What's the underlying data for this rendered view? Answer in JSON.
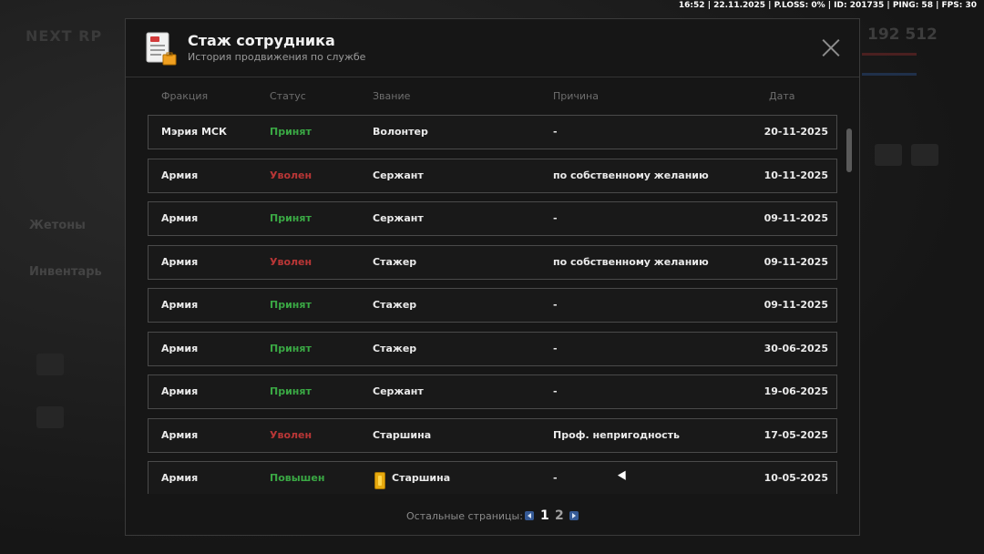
{
  "hud": "16:52 | 22.11.2025 | P.LOSS: 0% | ID: 201735 | PING: 58 | FPS: 30",
  "modal": {
    "title": "Стаж сотрудника",
    "subtitle": "История продвижения по службе"
  },
  "columns": {
    "faction": "Фракция",
    "status": "Статус",
    "rank": "Звание",
    "reason": "Причина",
    "date": "Дата"
  },
  "rows": [
    {
      "faction": "Мэрия МСК",
      "status": "Принят",
      "status_type": "accepted",
      "rank": "Волонтер",
      "reason": "-",
      "date": "20-11-2025"
    },
    {
      "faction": "Армия",
      "status": "Уволен",
      "status_type": "fired",
      "rank": "Сержант",
      "reason": "по собственному желанию",
      "date": "10-11-2025"
    },
    {
      "faction": "Армия",
      "status": "Принят",
      "status_type": "accepted",
      "rank": "Сержант",
      "reason": "-",
      "date": "09-11-2025"
    },
    {
      "faction": "Армия",
      "status": "Уволен",
      "status_type": "fired",
      "rank": "Стажер",
      "reason": "по собственному желанию",
      "date": "09-11-2025"
    },
    {
      "faction": "Армия",
      "status": "Принят",
      "status_type": "accepted",
      "rank": "Стажер",
      "reason": "-",
      "date": "09-11-2025"
    },
    {
      "faction": "Армия",
      "status": "Принят",
      "status_type": "accepted",
      "rank": "Стажер",
      "reason": "-",
      "date": "30-06-2025"
    },
    {
      "faction": "Армия",
      "status": "Принят",
      "status_type": "accepted",
      "rank": "Сержант",
      "reason": "-",
      "date": "19-06-2025"
    },
    {
      "faction": "Армия",
      "status": "Уволен",
      "status_type": "fired",
      "rank": "Старшина",
      "reason": "Проф. непригодность",
      "date": "17-05-2025"
    },
    {
      "faction": "Армия",
      "status": "Повышен",
      "status_type": "promoted",
      "rank": "Старшина",
      "reason": "-",
      "date": "10-05-2025",
      "rank_icon": "rank-badge-icon"
    }
  ],
  "pager": {
    "label": "Остальные страницы:",
    "pages": [
      "1",
      "2"
    ],
    "current": "1"
  },
  "background": {
    "logo": "NEXT RP",
    "tokens": "Жетоны",
    "inventory": "Инвентарь",
    "balance": "192 512"
  },
  "colors": {
    "accepted": "#3aa844",
    "fired": "#b93636",
    "accent": "#355a96",
    "badge": "#e6a90e"
  }
}
